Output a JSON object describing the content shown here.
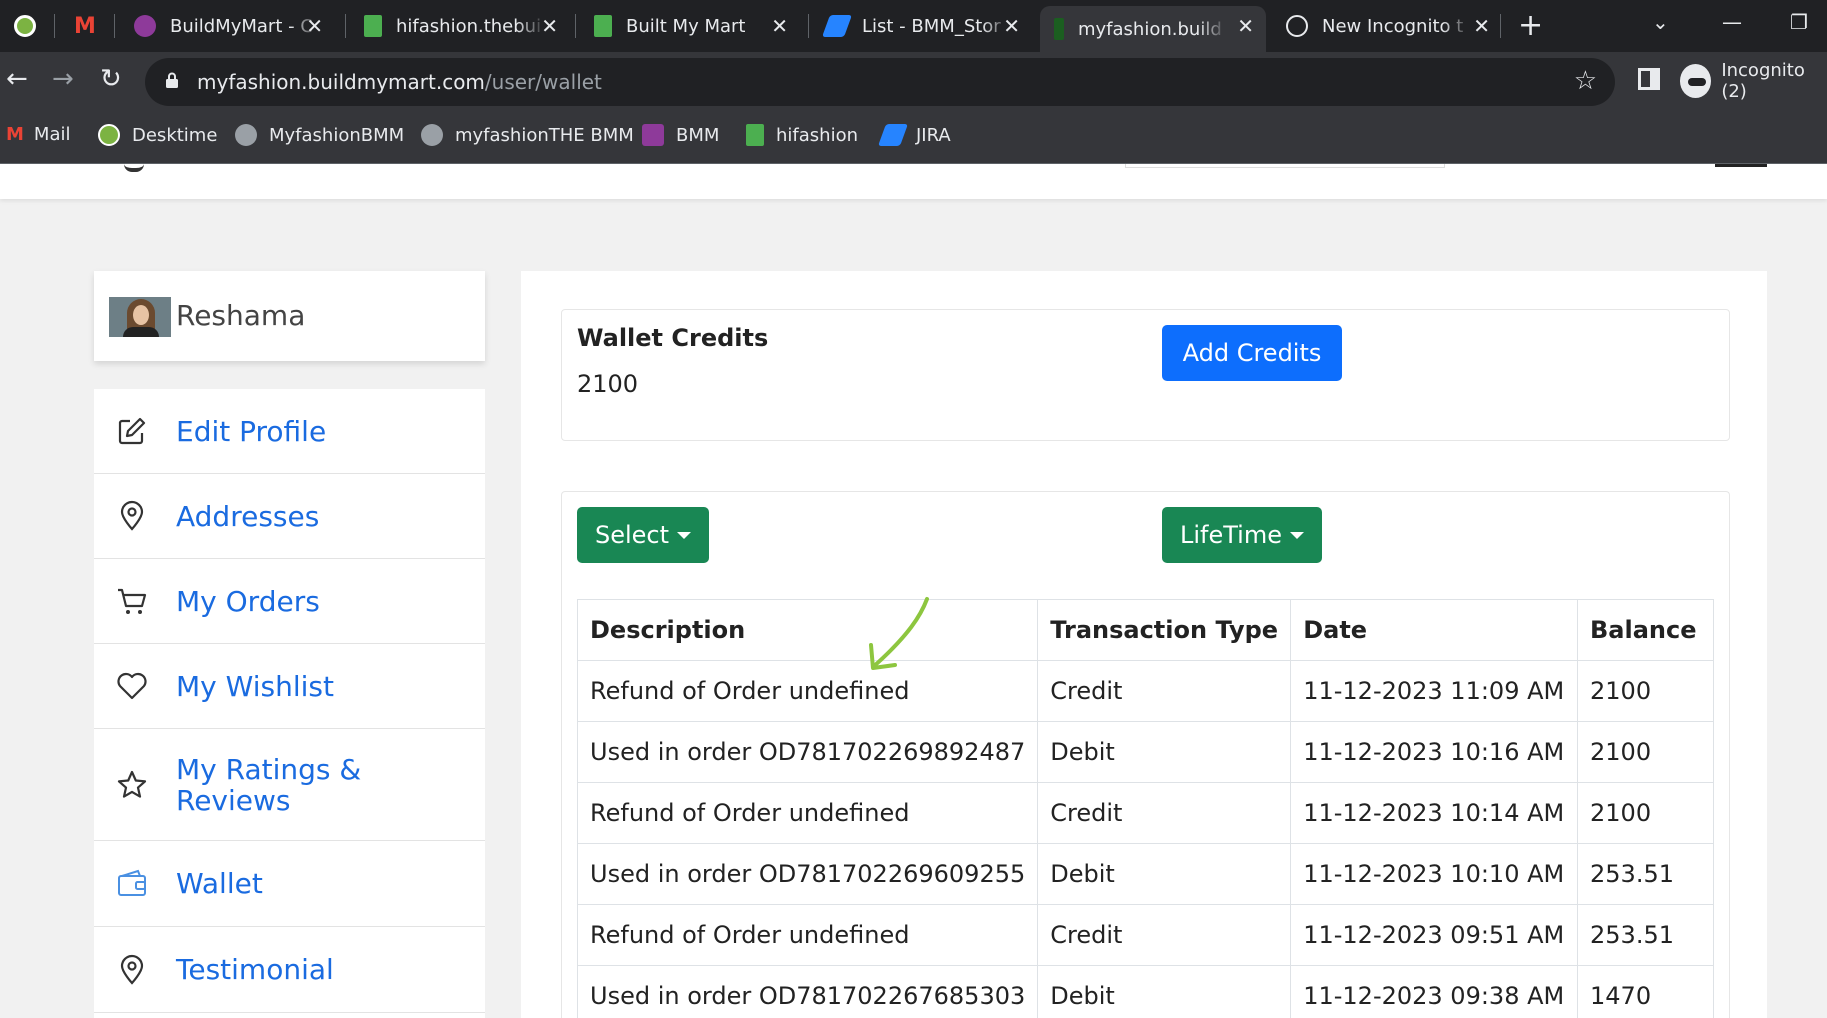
{
  "browser": {
    "tabs": [
      {
        "title": "",
        "favicon_color": "#7cb342"
      },
      {
        "title": "",
        "favicon_color": "#ea4335"
      },
      {
        "title": "BuildMyMart - C",
        "favicon_color": "#8e3a9a"
      },
      {
        "title": "hifashion.thebui",
        "favicon_color": "#4caf50"
      },
      {
        "title": "Built My Mart",
        "favicon_color": "#4caf50"
      },
      {
        "title": "List - BMM_Stor",
        "favicon_color": "#2684ff"
      },
      {
        "title": "myfashion.build",
        "favicon_color": "#1b5e20"
      },
      {
        "title": "New Incognito t",
        "favicon_color": "#e8eaed"
      }
    ],
    "active_tab_index": 6,
    "url": {
      "host": "myfashion.buildmymart.com",
      "path": "/user/wallet"
    },
    "profile_label": "Incognito (2)",
    "bookmarks": [
      {
        "label": "Mail",
        "icon": "gmail-icon",
        "color": "#ea4335"
      },
      {
        "label": "Desktime",
        "icon": "desktime-icon",
        "color": "#7cb342"
      },
      {
        "label": "MyfashionBMM",
        "icon": "globe-icon",
        "color": "#9aa0a6"
      },
      {
        "label": "myfashionTHE BMM",
        "icon": "globe-icon",
        "color": "#9aa0a6"
      },
      {
        "label": "BMM",
        "icon": "bmm-icon",
        "color": "#8e3a9a"
      },
      {
        "label": "hifashion",
        "icon": "hifashion-icon",
        "color": "#4caf50"
      },
      {
        "label": "JIRA",
        "icon": "jira-icon",
        "color": "#2684ff"
      }
    ]
  },
  "profile": {
    "name": "Reshama"
  },
  "sidebar": {
    "items": [
      {
        "label": "Edit Profile",
        "icon": "edit-icon"
      },
      {
        "label": "Addresses",
        "icon": "location-pin-icon"
      },
      {
        "label": "My Orders",
        "icon": "cart-icon"
      },
      {
        "label": "My Wishlist",
        "icon": "heart-icon"
      },
      {
        "label": "My Ratings & Reviews",
        "icon": "star-icon"
      },
      {
        "label": "Wallet",
        "icon": "wallet-icon"
      },
      {
        "label": "Testimonial",
        "icon": "location-pin-icon"
      }
    ]
  },
  "wallet": {
    "title": "Wallet Credits",
    "amount": "2100",
    "add_button": "Add Credits"
  },
  "filters": {
    "type_dropdown": "Select",
    "period_dropdown": "LifeTime"
  },
  "transactions": {
    "columns": [
      "Description",
      "Transaction Type",
      "Date",
      "Balance"
    ],
    "rows": [
      {
        "description": "Refund of Order undefined",
        "type": "Credit",
        "date": "11-12-2023 11:09 AM",
        "balance": "2100"
      },
      {
        "description": "Used in order OD781702269892487",
        "type": "Debit",
        "date": "11-12-2023 10:16 AM",
        "balance": "2100"
      },
      {
        "description": "Refund of Order undefined",
        "type": "Credit",
        "date": "11-12-2023 10:14 AM",
        "balance": "2100"
      },
      {
        "description": "Used in order OD781702269609255",
        "type": "Debit",
        "date": "11-12-2023 10:10 AM",
        "balance": "253.51"
      },
      {
        "description": "Refund of Order undefined",
        "type": "Credit",
        "date": "11-12-2023 09:51 AM",
        "balance": "253.51"
      },
      {
        "description": "Used in order OD781702267685303",
        "type": "Debit",
        "date": "11-12-2023 09:38 AM",
        "balance": "1470"
      }
    ]
  },
  "colors": {
    "link_blue": "#1a6be0",
    "primary_button": "#0d6efd",
    "success_button": "#198754",
    "annotation_arrow": "#8dc63f"
  }
}
